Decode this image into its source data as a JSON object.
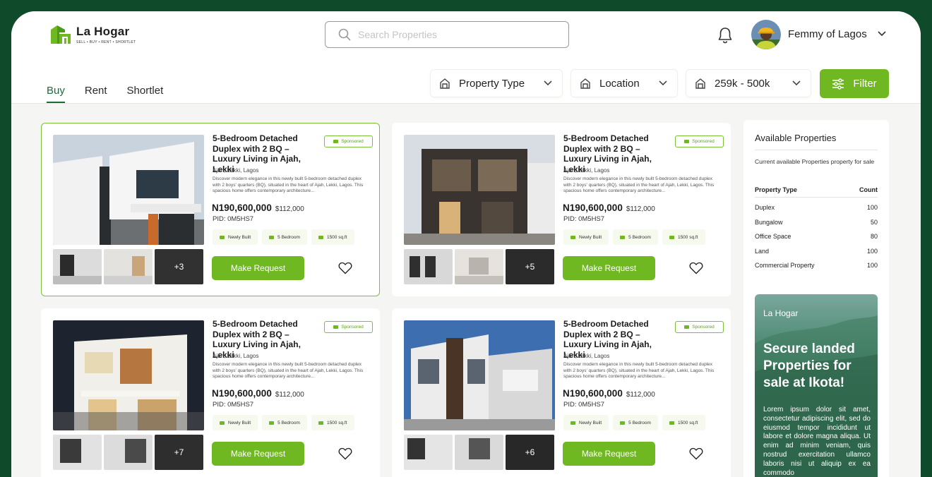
{
  "brand": {
    "name": "La Hogar",
    "tagline": "SELL • BUY • RENT • SHORTLET"
  },
  "search": {
    "placeholder": "Search Properties"
  },
  "user": {
    "name": "Femmy of Lagos"
  },
  "tabs": [
    {
      "label": "Buy",
      "active": true
    },
    {
      "label": "Rent"
    },
    {
      "label": "Shortlet"
    }
  ],
  "filters": {
    "property_type": "Property Type",
    "location": "Location",
    "price": "259k - 500k",
    "filter_button": "Filter"
  },
  "colors": {
    "accent": "#6fb822",
    "dark": "#0f4a2a",
    "tab_active": "#1e6b3a"
  },
  "listings": [
    {
      "title": "5-Bedroom Detached Duplex with 2 BQ – Luxury Living in Ajah, Lekki",
      "sponsored": "Sponsored",
      "location": "Ajah, Lekki, Lagos",
      "description": "Discover modern elegance in this newly built 5-bedroom detached duplex with 2 boys' quarters (BQ), situated in the heart of Ajah, Lekki, Lagos. This spacious home offers contemporary architecture...",
      "price": "N190,600,000",
      "usd": "$112,000",
      "pid": "PID: 0M5HS7",
      "features": [
        "Newly Built",
        "5 Bedroom",
        "1500 sq.ft"
      ],
      "more_photos": "+3",
      "button": "Make Request",
      "selected": true
    },
    {
      "title": "5-Bedroom Detached Duplex with 2 BQ – Luxury Living in Ajah, Lekki",
      "sponsored": "Sponsored",
      "location": "Ajah, Lekki, Lagos",
      "description": "Discover modern elegance in this newly built 5-bedroom detached duplex with 2 boys' quarters (BQ), situated in the heart of Ajah, Lekki, Lagos. This spacious home offers contemporary architecture...",
      "price": "N190,600,000",
      "usd": "$112,000",
      "pid": "PID: 0M5HS7",
      "features": [
        "Newly Built",
        "5 Bedroom",
        "1500 sq.ft"
      ],
      "more_photos": "+5",
      "button": "Make Request"
    },
    {
      "title": "5-Bedroom Detached Duplex with 2 BQ – Luxury Living in Ajah, Lekki",
      "sponsored": "Sponsored",
      "location": "Ajah, Lekki, Lagos",
      "description": "Discover modern elegance in this newly built 5-bedroom detached duplex with 2 boys' quarters (BQ), situated in the heart of Ajah, Lekki, Lagos. This spacious home offers contemporary architecture...",
      "price": "N190,600,000",
      "usd": "$112,000",
      "pid": "PID: 0M5HS7",
      "features": [
        "Newly Built",
        "5 Bedroom",
        "1500 sq.ft"
      ],
      "more_photos": "+7",
      "button": "Make Request"
    },
    {
      "title": "5-Bedroom Detached Duplex with 2 BQ – Luxury Living in Ajah, Lekki",
      "sponsored": "Sponsored",
      "location": "Ajah, Lekki, Lagos",
      "description": "Discover modern elegance in this newly built 5-bedroom detached duplex with 2 boys' quarters (BQ), situated in the heart of Ajah, Lekki, Lagos. This spacious home offers contemporary architecture...",
      "price": "N190,600,000",
      "usd": "$112,000",
      "pid": "PID: 0M5HS7",
      "features": [
        "Newly Built",
        "5 Bedroom",
        "1500 sq.ft"
      ],
      "more_photos": "+6",
      "button": "Make Request"
    }
  ],
  "sidebar": {
    "title": "Available Properties",
    "subtitle": "Current available Properties  property for sale",
    "col_type": "Property Type",
    "col_count": "Count",
    "rows": [
      {
        "type": "Duplex",
        "count": "100"
      },
      {
        "type": "Bungalow",
        "count": "50"
      },
      {
        "type": "Office Space",
        "count": "80"
      },
      {
        "type": "Land",
        "count": "100"
      },
      {
        "type": "Commercial Property",
        "count": "100"
      }
    ],
    "promo": {
      "brand": "La Hogar",
      "headline": "Secure landed Properties for sale at Ikota!",
      "body": "Lorem ipsum dolor sit amet, consectetur adipiscing elit, sed do eiusmod tempor incididunt ut labore et dolore magna aliqua. Ut enim ad minim veniam, quis nostrud exercitation ullamco laboris nisi ut aliquip ex ea commodo"
    }
  }
}
